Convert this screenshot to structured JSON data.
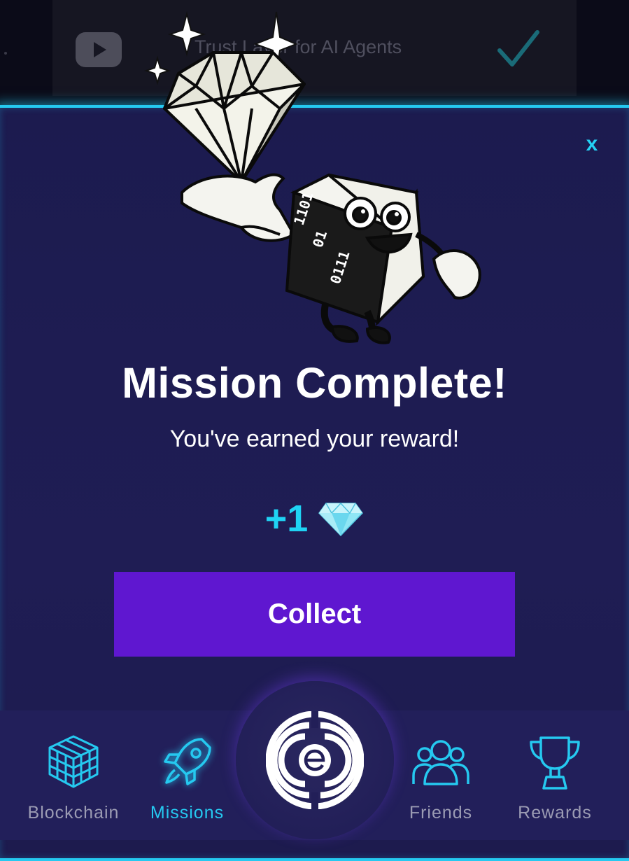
{
  "background_task": {
    "title": "Trust Layer for AI Agents"
  },
  "modal": {
    "close_label": "x",
    "title": "Mission Complete!",
    "subtitle": "You've earned your reward!",
    "reward": {
      "amount": "+1",
      "icon": "diamond-icon"
    },
    "collect_label": "Collect",
    "mascot_binary": [
      "1101",
      "01",
      "0111"
    ]
  },
  "bottom_nav": {
    "items": [
      {
        "label": "Blockchain",
        "icon": "cube-grid-icon",
        "active": false
      },
      {
        "label": "Missions",
        "icon": "rocket-icon",
        "active": true
      },
      {
        "label": "Friends",
        "icon": "people-icon",
        "active": false
      },
      {
        "label": "Rewards",
        "icon": "trophy-icon",
        "active": false
      }
    ],
    "center": {
      "icon": "brand-logo-icon"
    }
  },
  "colors": {
    "accent_cyan": "#25c9f0",
    "button_purple": "#5f17d0",
    "modal_bg": "#1c1b4f",
    "nav_bg": "#221f5a"
  }
}
